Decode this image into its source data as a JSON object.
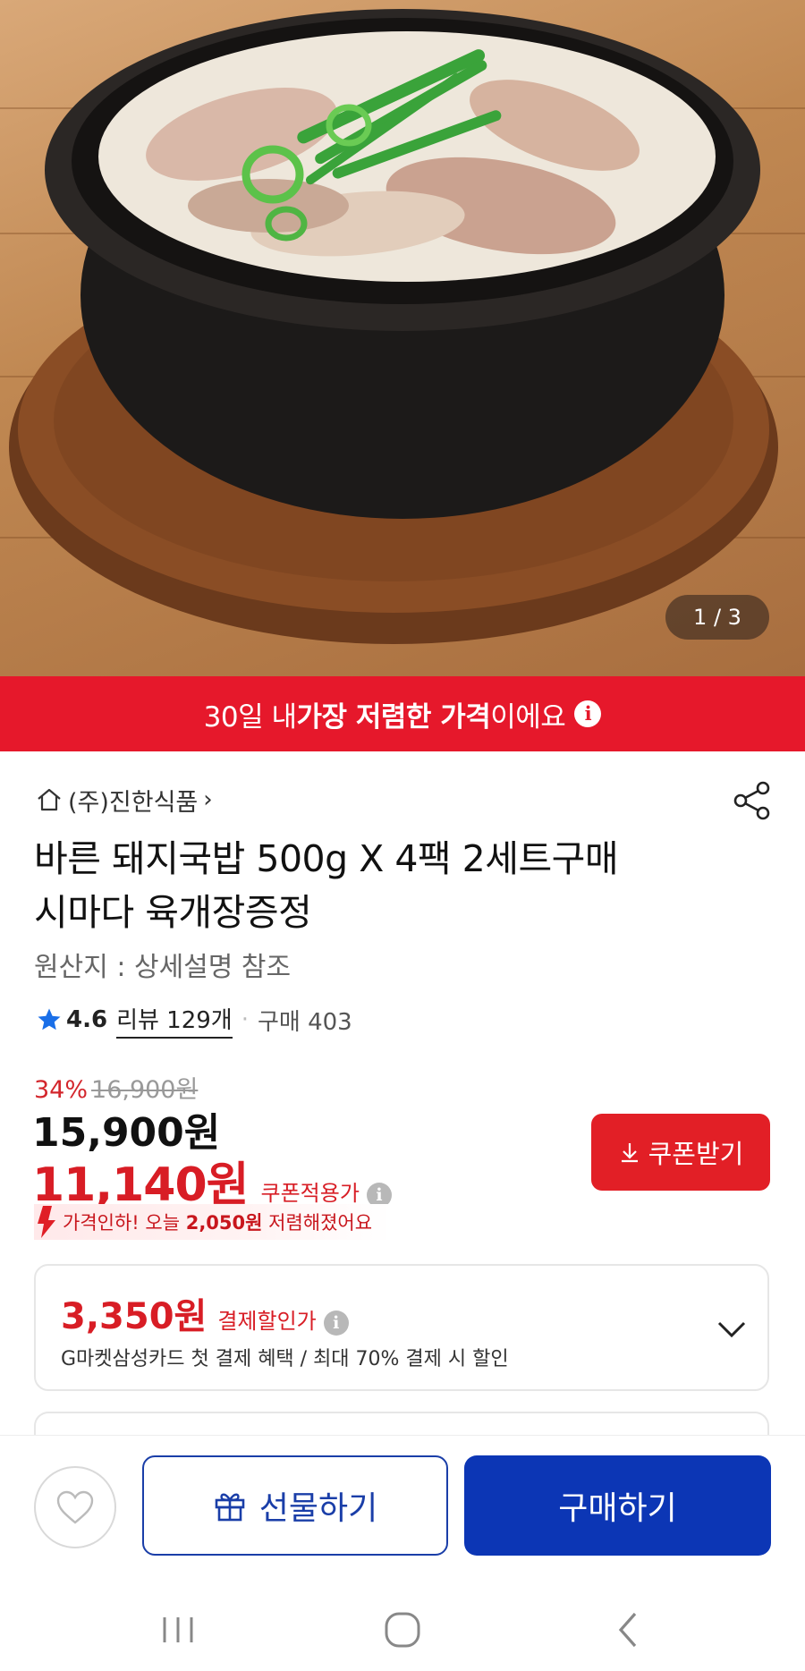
{
  "hero": {
    "image_alt": "돼지국밥",
    "counter_current": "1",
    "counter_sep": " / ",
    "counter_total": "3"
  },
  "banner": {
    "prefix": "30일 내 ",
    "highlight": "가장 저렴한 가격",
    "suffix": "이에요",
    "info_icon": "i"
  },
  "seller": {
    "name": "(주)진한식품",
    "chevron": "›",
    "icons": {
      "home": "home-icon",
      "share": "share-icon"
    }
  },
  "product": {
    "title_line1": "바른 돼지국밥 500g X 4팩 2세트구매",
    "title_line2": "시마다 육개장증정",
    "origin": "원산지 : 상세설명 참조"
  },
  "rating": {
    "score": "4.6",
    "review_text": "리뷰 129개",
    "separator": "·",
    "purchase_text": "구매 403",
    "star_color": "#1a6fe8"
  },
  "price": {
    "discount_pct": "34%",
    "original": "16,900원",
    "sale": "15,900원",
    "coupon_price": "11,140원",
    "coupon_label": "쿠폰적용가",
    "info_icon": "i",
    "coupon_button": "쿠폰받기",
    "drop_prefix": "가격인하! 오늘 ",
    "drop_amount": "2,050원",
    "drop_suffix": " 저렴해졌어요"
  },
  "payment": {
    "amount": "3,350원",
    "label": "결제할인가",
    "info_icon": "i",
    "description": "G마켓삼성카드 첫 결제 혜택 / 최대 70% 결제 시 할인"
  },
  "actions": {
    "gift_label": "선물하기",
    "buy_label": "구매하기"
  },
  "colors": {
    "banner_red": "#e6182b",
    "price_red": "#d81d25",
    "buy_blue": "#0c36b5"
  }
}
